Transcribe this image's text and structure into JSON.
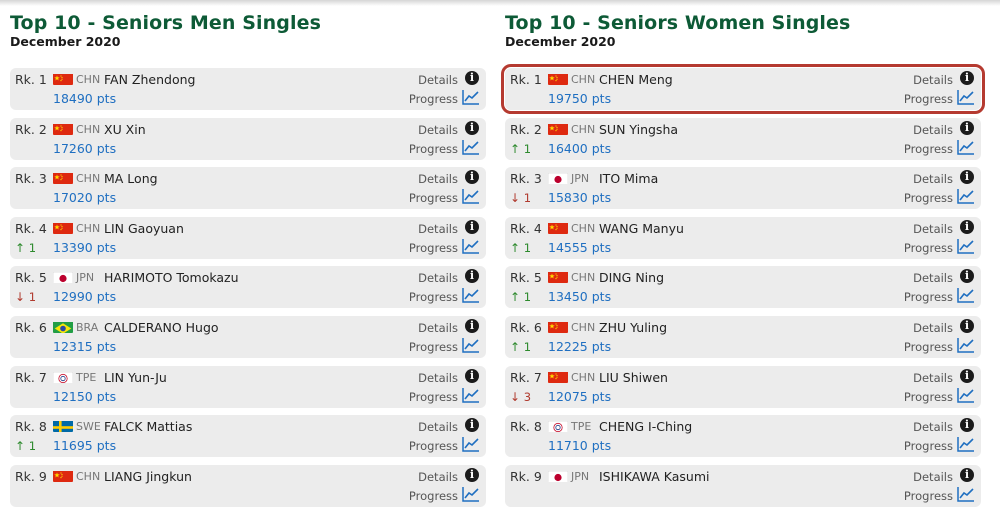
{
  "men": {
    "title": "Top 10 - Seniors Men Singles",
    "subtitle": "December 2020",
    "rows": [
      {
        "rank": "Rk. 1",
        "flag": "chn",
        "nat": "CHN",
        "name": "FAN Zhendong",
        "pts": "18490 pts",
        "change": "",
        "dir": ""
      },
      {
        "rank": "Rk. 2",
        "flag": "chn",
        "nat": "CHN",
        "name": "XU Xin",
        "pts": "17260 pts",
        "change": "",
        "dir": ""
      },
      {
        "rank": "Rk. 3",
        "flag": "chn",
        "nat": "CHN",
        "name": "MA Long",
        "pts": "17020 pts",
        "change": "",
        "dir": ""
      },
      {
        "rank": "Rk. 4",
        "flag": "chn",
        "nat": "CHN",
        "name": "LIN Gaoyuan",
        "pts": "13390 pts",
        "change": "1",
        "dir": "up"
      },
      {
        "rank": "Rk. 5",
        "flag": "jpn",
        "nat": "JPN",
        "name": "HARIMOTO Tomokazu",
        "pts": "12990 pts",
        "change": "1",
        "dir": "down"
      },
      {
        "rank": "Rk. 6",
        "flag": "bra",
        "nat": "BRA",
        "name": "CALDERANO Hugo",
        "pts": "12315 pts",
        "change": "",
        "dir": ""
      },
      {
        "rank": "Rk. 7",
        "flag": "tpe",
        "nat": "TPE",
        "name": "LIN Yun-Ju",
        "pts": "12150 pts",
        "change": "",
        "dir": ""
      },
      {
        "rank": "Rk. 8",
        "flag": "swe",
        "nat": "SWE",
        "name": "FALCK Mattias",
        "pts": "11695 pts",
        "change": "1",
        "dir": "up"
      },
      {
        "rank": "Rk. 9",
        "flag": "chn",
        "nat": "CHN",
        "name": "LIANG Jingkun",
        "pts": "",
        "change": "",
        "dir": ""
      }
    ]
  },
  "women": {
    "title": "Top 10 - Seniors Women Singles",
    "subtitle": "December 2020",
    "rows": [
      {
        "rank": "Rk. 1",
        "flag": "chn",
        "nat": "CHN",
        "name": "CHEN Meng",
        "pts": "19750 pts",
        "change": "",
        "dir": "",
        "highlight": true
      },
      {
        "rank": "Rk. 2",
        "flag": "chn",
        "nat": "CHN",
        "name": "SUN Yingsha",
        "pts": "16400 pts",
        "change": "1",
        "dir": "up"
      },
      {
        "rank": "Rk. 3",
        "flag": "jpn",
        "nat": "JPN",
        "name": "ITO Mima",
        "pts": "15830 pts",
        "change": "1",
        "dir": "down"
      },
      {
        "rank": "Rk. 4",
        "flag": "chn",
        "nat": "CHN",
        "name": "WANG Manyu",
        "pts": "14555 pts",
        "change": "1",
        "dir": "up"
      },
      {
        "rank": "Rk. 5",
        "flag": "chn",
        "nat": "CHN",
        "name": "DING Ning",
        "pts": "13450 pts",
        "change": "1",
        "dir": "up"
      },
      {
        "rank": "Rk. 6",
        "flag": "chn",
        "nat": "CHN",
        "name": "ZHU Yuling",
        "pts": "12225 pts",
        "change": "1",
        "dir": "up"
      },
      {
        "rank": "Rk. 7",
        "flag": "chn",
        "nat": "CHN",
        "name": "LIU Shiwen",
        "pts": "12075 pts",
        "change": "3",
        "dir": "down"
      },
      {
        "rank": "Rk. 8",
        "flag": "tpe",
        "nat": "TPE",
        "name": "CHENG I-Ching",
        "pts": "11710 pts",
        "change": "",
        "dir": ""
      },
      {
        "rank": "Rk. 9",
        "flag": "jpn",
        "nat": "JPN",
        "name": "ISHIKAWA Kasumi",
        "pts": "",
        "change": "",
        "dir": ""
      }
    ]
  },
  "labels": {
    "details": "Details",
    "progress": "Progress"
  },
  "icons": {
    "details": "info-icon",
    "progress": "chart-line-icon",
    "up": "arrow-up-icon",
    "down": "arrow-down-icon"
  },
  "colors": {
    "title": "#0d5a36",
    "points": "#1f6fc1",
    "up": "#2d8a2d",
    "down": "#b03a2e",
    "highlight": "#b53a30"
  }
}
